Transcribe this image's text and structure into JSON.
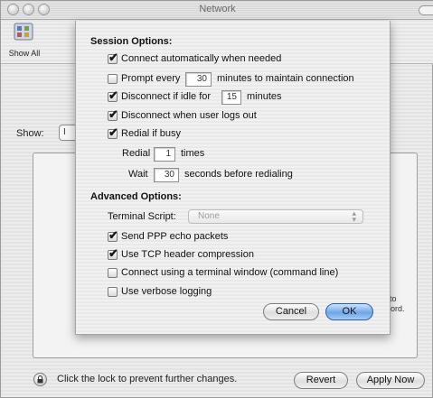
{
  "window": {
    "title": "Network"
  },
  "toolbar": {
    "show_all_label": "Show All"
  },
  "background": {
    "show_label": "Show:",
    "show_popup_value": "I",
    "text_fragment_1": "to",
    "text_fragment_2": "sword."
  },
  "footer": {
    "lock_text": "Click the lock to prevent further changes.",
    "revert_label": "Revert",
    "apply_label": "Apply Now"
  },
  "sheet": {
    "session_heading": "Session Options:",
    "connect_auto": {
      "label": "Connect automatically when needed",
      "checked": true
    },
    "prompt_every": {
      "label_before": "Prompt every",
      "value": "30",
      "label_after": "minutes to maintain connection",
      "checked": false
    },
    "disconnect_idle": {
      "label_before": "Disconnect if idle for",
      "value": "15",
      "label_after": "minutes",
      "checked": true
    },
    "disconnect_logout": {
      "label": "Disconnect when user logs out",
      "checked": true
    },
    "redial_if_busy": {
      "label": "Redial if busy",
      "checked": true
    },
    "redial": {
      "label": "Redial",
      "value": "1",
      "suffix": "times"
    },
    "wait": {
      "label": "Wait",
      "value": "30",
      "suffix": "seconds before redialing"
    },
    "advanced_heading": "Advanced Options:",
    "terminal_script": {
      "label": "Terminal Script:",
      "value": "None"
    },
    "send_ppp_echo": {
      "label": "Send PPP echo packets",
      "checked": true
    },
    "tcp_compression": {
      "label": "Use TCP header compression",
      "checked": true
    },
    "terminal_window": {
      "label": "Connect using a terminal window (command line)",
      "checked": false
    },
    "verbose_logging": {
      "label": "Use verbose logging",
      "checked": false
    },
    "cancel_label": "Cancel",
    "ok_label": "OK"
  },
  "icons": {
    "checkmark": "✔",
    "select_arrows": "stepper-arrows-icon",
    "lock": "lock-icon",
    "show_all": "show-all-icon"
  },
  "colors": {
    "ok_button": "#6ea6e6",
    "window_background": "#ececec",
    "sheet_background": "#f1f1f1"
  }
}
